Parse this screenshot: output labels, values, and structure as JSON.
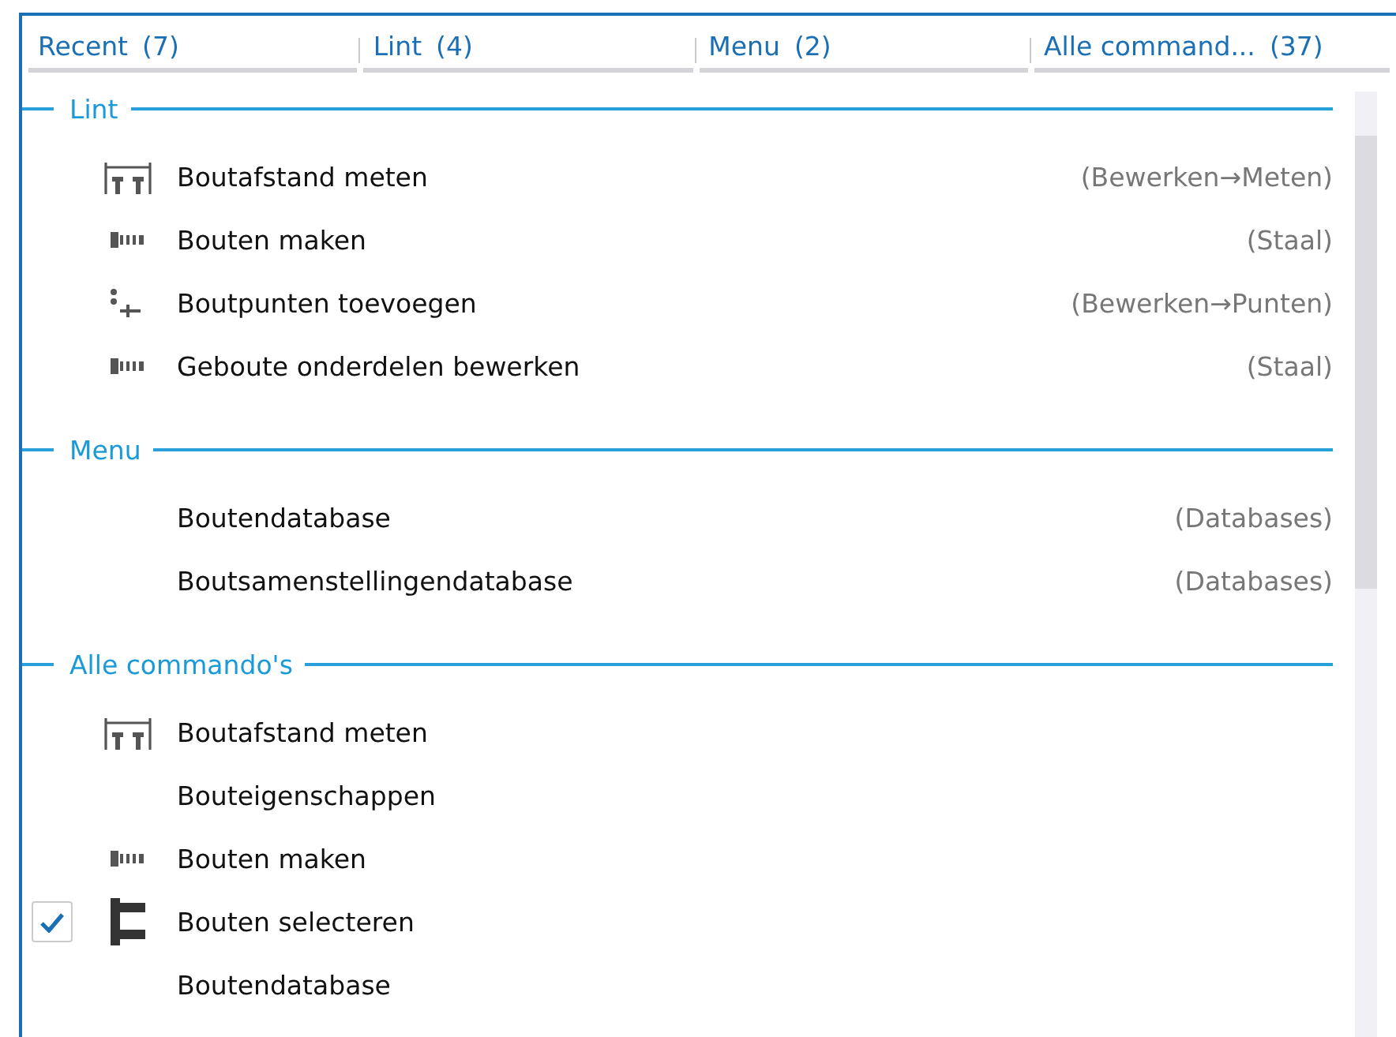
{
  "tabs": [
    {
      "label": "Recent",
      "count": "(7)"
    },
    {
      "label": "Lint",
      "count": "(4)"
    },
    {
      "label": "Menu",
      "count": "(2)"
    },
    {
      "label": "Alle command...",
      "count": "(37)"
    }
  ],
  "sections": [
    {
      "title": "Lint",
      "items": [
        {
          "kind": "measure",
          "label": "Boutafstand meten",
          "location": "(Bewerken→Meten)"
        },
        {
          "kind": "bolts",
          "label": "Bouten maken",
          "location": "(Staal)"
        },
        {
          "kind": "points",
          "label": "Boutpunten toevoegen",
          "location": "(Bewerken→Punten)"
        },
        {
          "kind": "bolts",
          "label": "Geboute onderdelen bewerken",
          "location": "(Staal)"
        }
      ]
    },
    {
      "title": "Menu",
      "items": [
        {
          "kind": "plain",
          "label": "Boutendatabase",
          "location": "(Databases)"
        },
        {
          "kind": "plain",
          "label": "Boutsamenstellingendatabase",
          "location": "(Databases)"
        }
      ]
    },
    {
      "title": "Alle commando's",
      "items": [
        {
          "kind": "measure",
          "label": "Boutafstand meten"
        },
        {
          "kind": "plain",
          "label": "Bouteigenschappen"
        },
        {
          "kind": "bolts",
          "label": "Bouten maken"
        },
        {
          "kind": "select",
          "label": "Bouten selecteren",
          "checkbox": {
            "checked": true
          }
        },
        {
          "kind": "plain",
          "label": "Boutendatabase"
        }
      ]
    }
  ]
}
